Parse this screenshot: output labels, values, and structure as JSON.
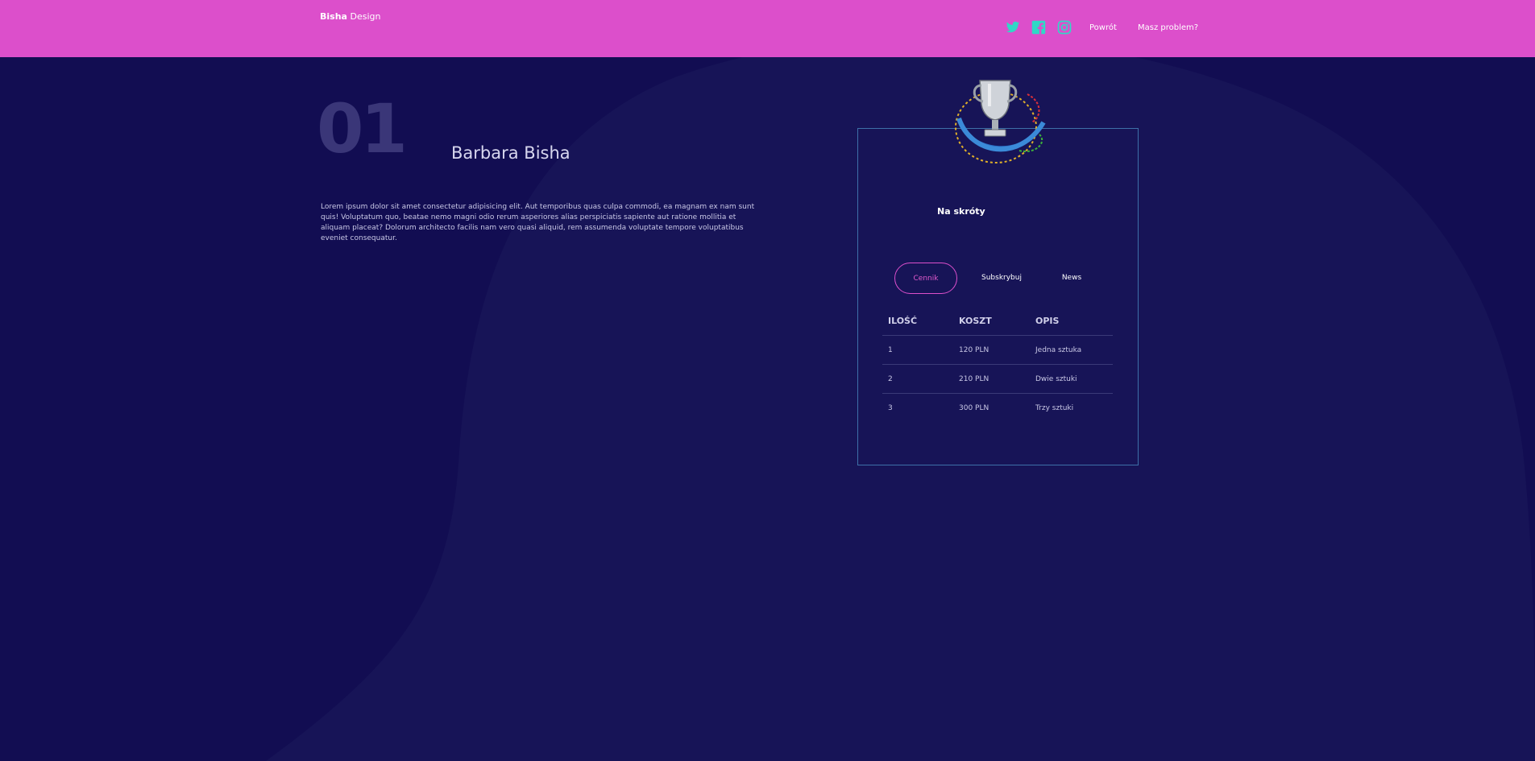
{
  "brand": {
    "bold": "Bisha",
    "rest": "Design"
  },
  "header": {
    "social": [
      "twitter-icon",
      "facebook-icon",
      "instagram-icon"
    ],
    "links": [
      {
        "label": "Powrót"
      },
      {
        "label": "Masz problem?"
      }
    ]
  },
  "hero": {
    "number": "01",
    "name": "Barbara Bisha",
    "text": "Lorem ipsum dolor sit amet consectetur adipisicing elit. Aut temporibus quas culpa commodi, ea magnam ex nam sunt quis! Voluptatum quo, beatae nemo magni odio rerum asperiores alias perspiciatis sapiente aut ratione mollitia et aliquam placeat? Dolorum architecto facilis nam vero quasi aliquid, rem assumenda voluptate tempore voluptatibus eveniet consequatur."
  },
  "card": {
    "title": "Na skróty",
    "tabs": [
      "Cennik",
      "Subskrybuj",
      "News"
    ],
    "active_tab": "Cennik",
    "table": {
      "headers": [
        "ILOŚĆ",
        "KOSZT",
        "OPIS"
      ],
      "rows": [
        [
          "1",
          "120 PLN",
          "Jedna sztuka"
        ],
        [
          "2",
          "210 PLN",
          "Dwie sztuki"
        ],
        [
          "3",
          "300 PLN",
          "Trzy sztuki"
        ]
      ]
    }
  },
  "colors": {
    "background": "#120d52",
    "header": "#dc4fcb",
    "social_icons": "#2fd9c6",
    "card_border": "#3d70a8",
    "accent": "#dc4fcb"
  }
}
